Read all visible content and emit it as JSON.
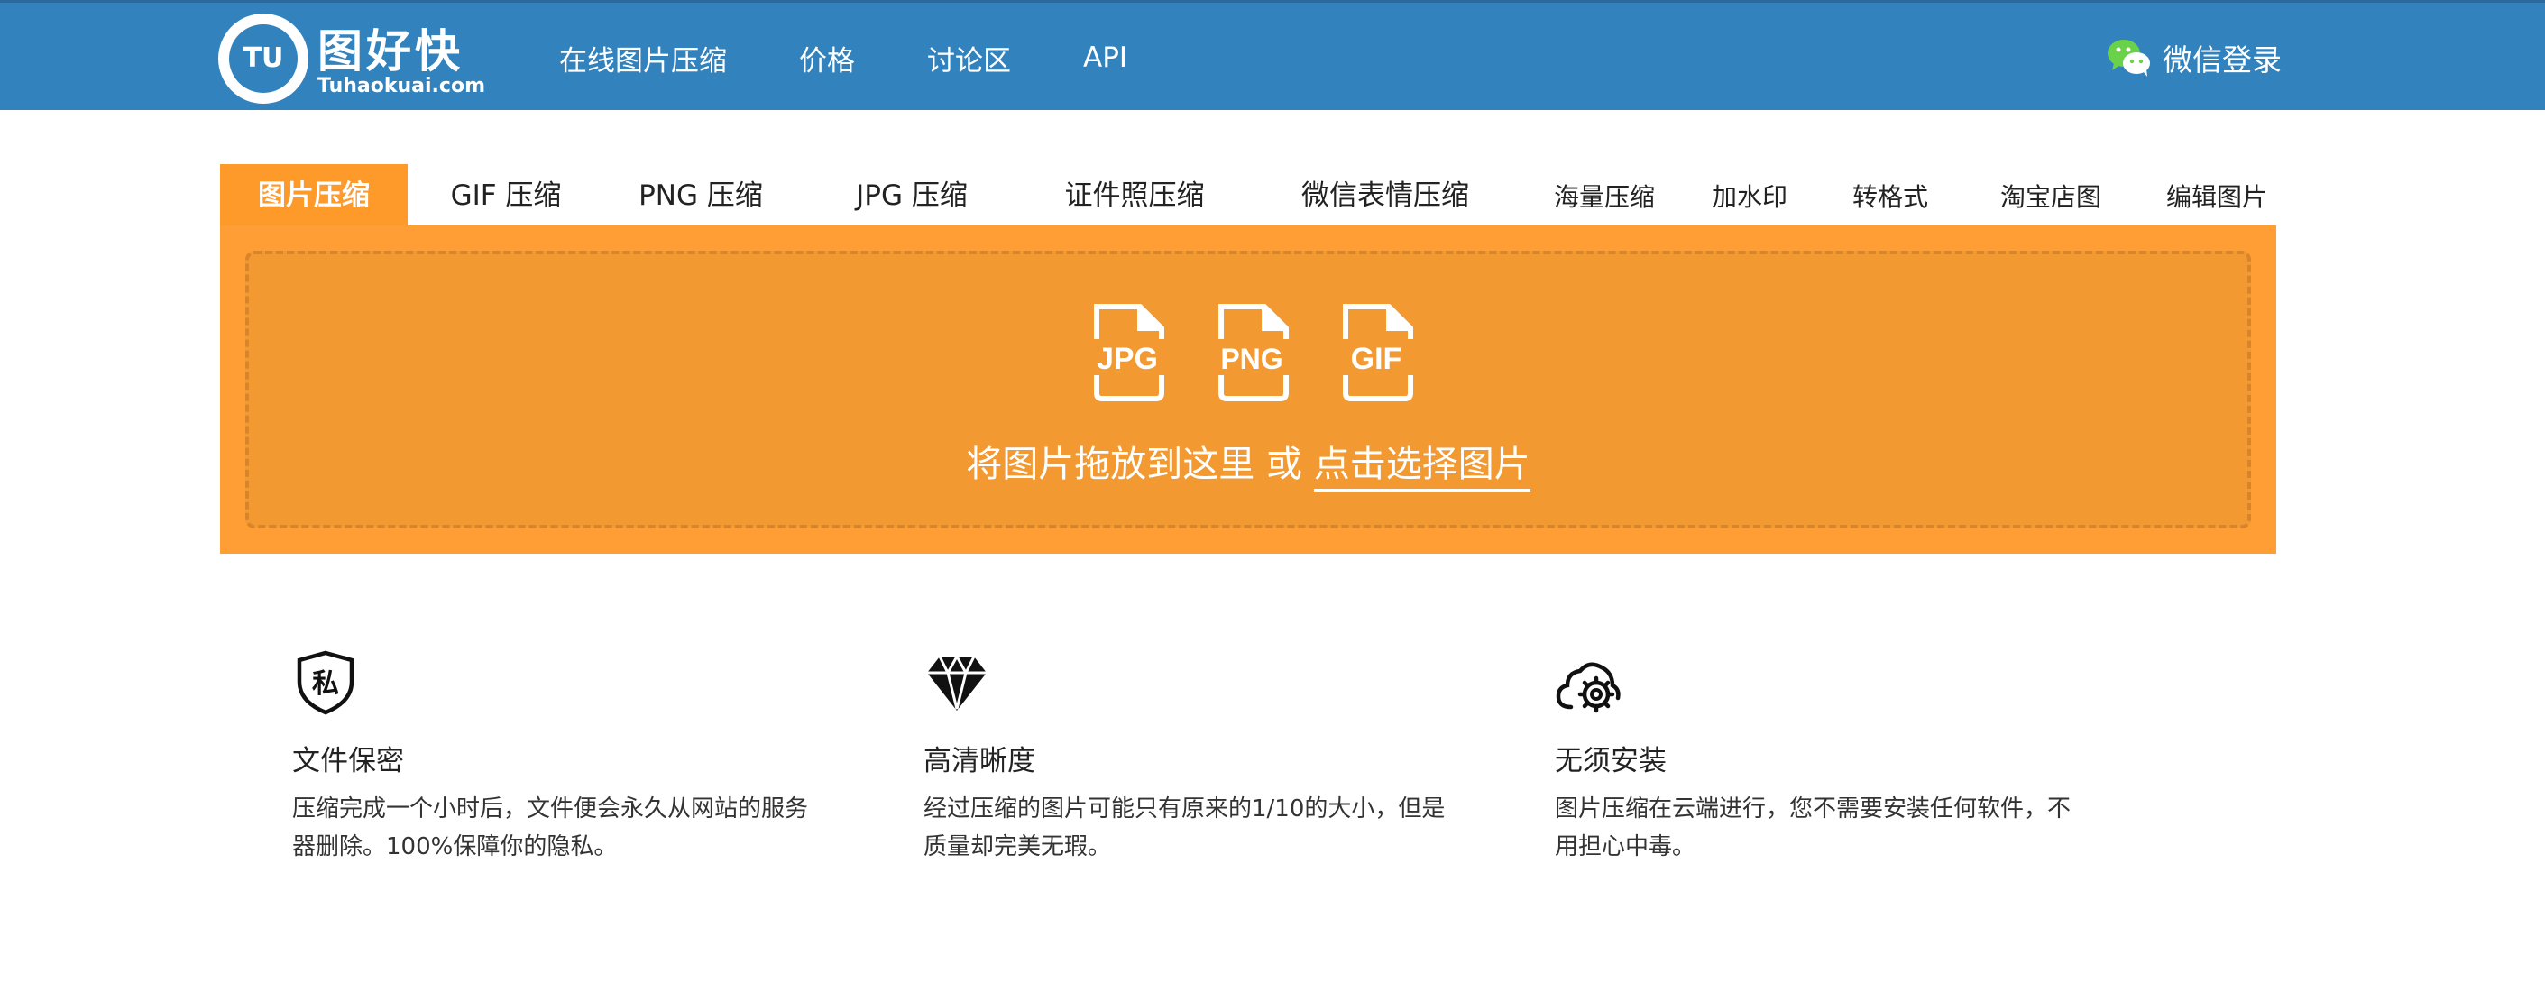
{
  "header": {
    "logo_text_cn": "图好快",
    "logo_text_en": "Tuhaokuai.com",
    "logo_mark": "TU",
    "nav": [
      "在线图片压缩",
      "价格",
      "讨论区",
      "API"
    ],
    "login_label": "微信登录"
  },
  "tabs": [
    {
      "label": "图片压缩",
      "active": true
    },
    {
      "label": "GIF 压缩"
    },
    {
      "label": "PNG 压缩"
    },
    {
      "label": "JPG 压缩"
    },
    {
      "label": "证件照压缩"
    },
    {
      "label": "微信表情压缩"
    },
    {
      "label": "海量压缩"
    },
    {
      "label": "加水印"
    },
    {
      "label": "转格式"
    },
    {
      "label": "淘宝店图"
    },
    {
      "label": "编辑图片"
    }
  ],
  "upload": {
    "file_types": [
      "JPG",
      "PNG",
      "GIF"
    ],
    "drop_text": "将图片拖放到这里 或 ",
    "choose_label": "点击选择图片"
  },
  "features": [
    {
      "icon": "privacy-shield-icon",
      "icon_char": "私",
      "title": "文件保密",
      "desc": [
        "压缩完成一个小时后，文件便会永久从网站的服务",
        "器删除。100%保障你的隐私。"
      ]
    },
    {
      "icon": "diamond-icon",
      "title": "高清晰度",
      "desc": [
        "经过压缩的图片可能只有原来的1/10的大小，但是",
        "质量却完美无瑕。"
      ]
    },
    {
      "icon": "cloud-gear-icon",
      "title": "无须安装",
      "desc": [
        "图片压缩在云端进行，您不需要安装任何软件，不",
        "用担心中毒。"
      ]
    }
  ],
  "colors": {
    "header": "#3282bd",
    "accent": "#fe9a2a",
    "upload_bg": "#f29932"
  }
}
